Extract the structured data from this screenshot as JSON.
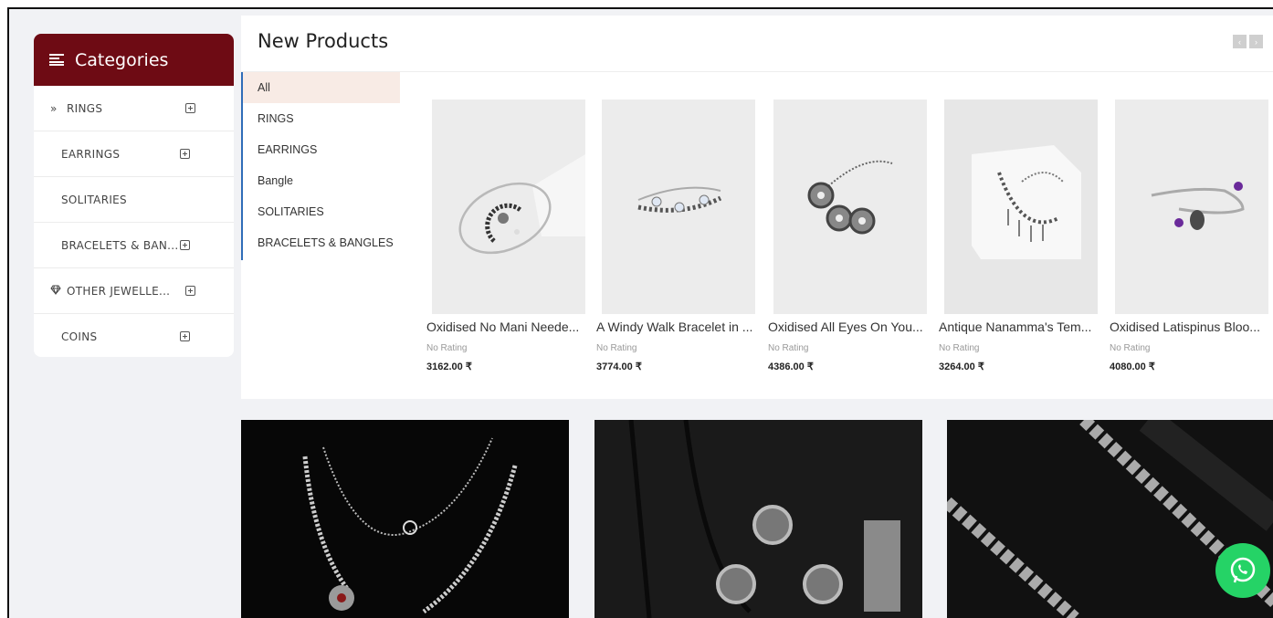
{
  "sidebar": {
    "title": "Categories",
    "items": [
      {
        "label": "RINGS",
        "lead": "»",
        "expandable": true
      },
      {
        "label": "EARRINGS",
        "lead": "",
        "expandable": true
      },
      {
        "label": "SOLITARIES",
        "lead": "",
        "expandable": false
      },
      {
        "label": "BRACELETS & BAN...",
        "lead": "",
        "expandable": true
      },
      {
        "label": "OTHER JEWELLE...",
        "lead": "gem-icon",
        "expandable": true
      },
      {
        "label": "COINS",
        "lead": "",
        "expandable": true
      }
    ]
  },
  "products": {
    "title": "New Products",
    "prev_label": "‹",
    "next_label": "›",
    "filters": [
      {
        "label": "All",
        "active": true
      },
      {
        "label": "RINGS",
        "active": false
      },
      {
        "label": "EARRINGS",
        "active": false
      },
      {
        "label": "Bangle",
        "active": false
      },
      {
        "label": "SOLITARIES",
        "active": false
      },
      {
        "label": "BRACELETS & BANGLES",
        "active": false
      }
    ],
    "items": [
      {
        "name": "Oxidised No Mani Neede...",
        "rating": "No Rating",
        "price": "3162.00 ₹"
      },
      {
        "name": "A Windy Walk Bracelet in ...",
        "rating": "No Rating",
        "price": "3774.00 ₹"
      },
      {
        "name": "Oxidised All Eyes On You...",
        "rating": "No Rating",
        "price": "4386.00 ₹"
      },
      {
        "name": "Antique Nanamma's Tem...",
        "rating": "No Rating",
        "price": "3264.00 ₹"
      },
      {
        "name": "Oxidised Latispinus Bloo...",
        "rating": "No Rating",
        "price": "4080.00 ₹"
      }
    ]
  },
  "colors": {
    "sidebar_header": "#6e0b14",
    "active_filter_bg": "#f8ebe5",
    "filter_border": "#2f6db8",
    "whatsapp": "#25d366"
  }
}
